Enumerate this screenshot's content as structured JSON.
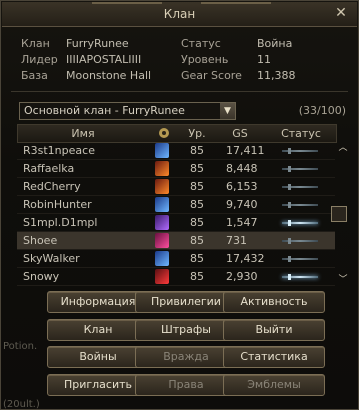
{
  "window": {
    "title": "Клан",
    "close_glyph": "✕"
  },
  "info": {
    "clan_label": "Клан",
    "clan_value": "FurryRunee",
    "leader_label": "Лидер",
    "leader_value": "IIIIAPOSTALIIII",
    "base_label": "База",
    "base_value": "Moonstone Hall",
    "status_label": "Статус",
    "status_value": "Война",
    "level_label": "Уровень",
    "level_value": "11",
    "gearscore_label": "Gear Score",
    "gearscore_value": "11,388"
  },
  "selector": {
    "selected": "Основной клан - FurryRunee",
    "count": "(33/100)"
  },
  "table": {
    "headers": {
      "name": "Имя",
      "level": "Ур.",
      "gs": "GS",
      "status": "Статус"
    },
    "rows": [
      {
        "name": "R3st1npeace",
        "level": "85",
        "gs": "17,411",
        "class_icon": "class-icon-blue",
        "online": false
      },
      {
        "name": "Raffaelka",
        "level": "85",
        "gs": "8,448",
        "class_icon": "class-icon-fire",
        "online": false
      },
      {
        "name": "RedCherry",
        "level": "85",
        "gs": "6,153",
        "class_icon": "class-icon-fire",
        "online": false
      },
      {
        "name": "RobinHunter",
        "level": "85",
        "gs": "9,740",
        "class_icon": "class-icon-blue",
        "online": false
      },
      {
        "name": "S1mpl.D1mpl",
        "level": "85",
        "gs": "1,547",
        "class_icon": "class-icon-purple",
        "online": true
      },
      {
        "name": "Shoee",
        "level": "85",
        "gs": "731",
        "class_icon": "class-icon-pink",
        "online": false,
        "selected": true
      },
      {
        "name": "SkyWalker",
        "level": "85",
        "gs": "17,432",
        "class_icon": "class-icon-blue",
        "online": false
      },
      {
        "name": "Snowy",
        "level": "85",
        "gs": "2,930",
        "class_icon": "class-icon-red",
        "online": true
      }
    ]
  },
  "buttons": [
    {
      "id": "info",
      "label": "Информация",
      "enabled": true
    },
    {
      "id": "privileges",
      "label": "Привилегии",
      "enabled": true
    },
    {
      "id": "activity",
      "label": "Активность",
      "enabled": true
    },
    {
      "id": "clan",
      "label": "Клан",
      "enabled": true
    },
    {
      "id": "fines",
      "label": "Штрафы",
      "enabled": true
    },
    {
      "id": "leave",
      "label": "Выйти",
      "enabled": true
    },
    {
      "id": "wars",
      "label": "Войны",
      "enabled": true
    },
    {
      "id": "enmity",
      "label": "Вражда",
      "enabled": false
    },
    {
      "id": "stats",
      "label": "Статистика",
      "enabled": true
    },
    {
      "id": "invite",
      "label": "Пригласить",
      "enabled": true
    },
    {
      "id": "rights",
      "label": "Права",
      "enabled": false
    },
    {
      "id": "emblems",
      "label": "Эмблемы",
      "enabled": false
    }
  ],
  "background_text": {
    "left_mid": "Potion.",
    "bottom_left": "(20ult.)"
  },
  "colors": {
    "online": "#cfe6f4",
    "selected_row": "#3b352c"
  }
}
